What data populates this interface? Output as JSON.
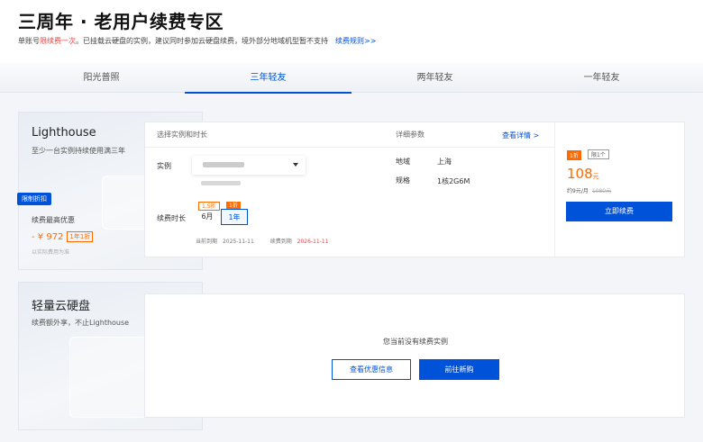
{
  "header": {
    "title": "三周年 · 老用户续费专区",
    "subtitle_pre": "单账号",
    "subtitle_red": "限续费一次",
    "subtitle_post": "。已挂载云硬盘的实例，建议同时参加云硬盘续费，境外部分地域机型暂不支持",
    "rules_link": "续费规则>>"
  },
  "tabs": [
    {
      "label": "阳光普照",
      "active": false
    },
    {
      "label": "三年轻友",
      "active": true
    },
    {
      "label": "两年轻友",
      "active": false
    },
    {
      "label": "一年轻友",
      "active": false
    }
  ],
  "lighthouse": {
    "title": "Lighthouse",
    "desc": "至少一台实例持续使用满三年",
    "promo_tag": "限制折扣",
    "best_label": "续费最高优惠",
    "best_value": "- ¥ 972",
    "best_badge": "1年1折",
    "note": "以实际费用为准"
  },
  "renew_table": {
    "col_select": "选择实例和时长",
    "col_params": "详细参数",
    "details_link": "查看详情 >",
    "instance_label": "实例",
    "duration_label": "续费时长",
    "durations": [
      {
        "label": "6月",
        "badge": "1.5折",
        "selected": false
      },
      {
        "label": "1年",
        "badge": "1折",
        "selected": true
      }
    ],
    "current_expire_label": "当前到期",
    "current_expire": "2025-11-11",
    "renew_expire_label": "续费到期",
    "renew_expire": "2026-11-11",
    "region_label": "地域",
    "region_value": "上海",
    "spec_label": "规格",
    "spec_value": "1核2G6M"
  },
  "buy": {
    "tag_discount": "1折",
    "tag_limit": "限1个",
    "price": "108",
    "price_unit": "元",
    "monthly": "约9元/月",
    "original": "1080元",
    "renew_button": "立即续费"
  },
  "disk": {
    "title": "轻量云硬盘",
    "desc": "续费额外享，不止Lighthouse",
    "empty_text": "您当前没有续费实例",
    "view_offer_button": "查看优惠信息",
    "new_purchase_button": "前往新购"
  },
  "colors": {
    "primary": "#0052d9",
    "accent": "#ff6a00",
    "red": "#e54545"
  }
}
